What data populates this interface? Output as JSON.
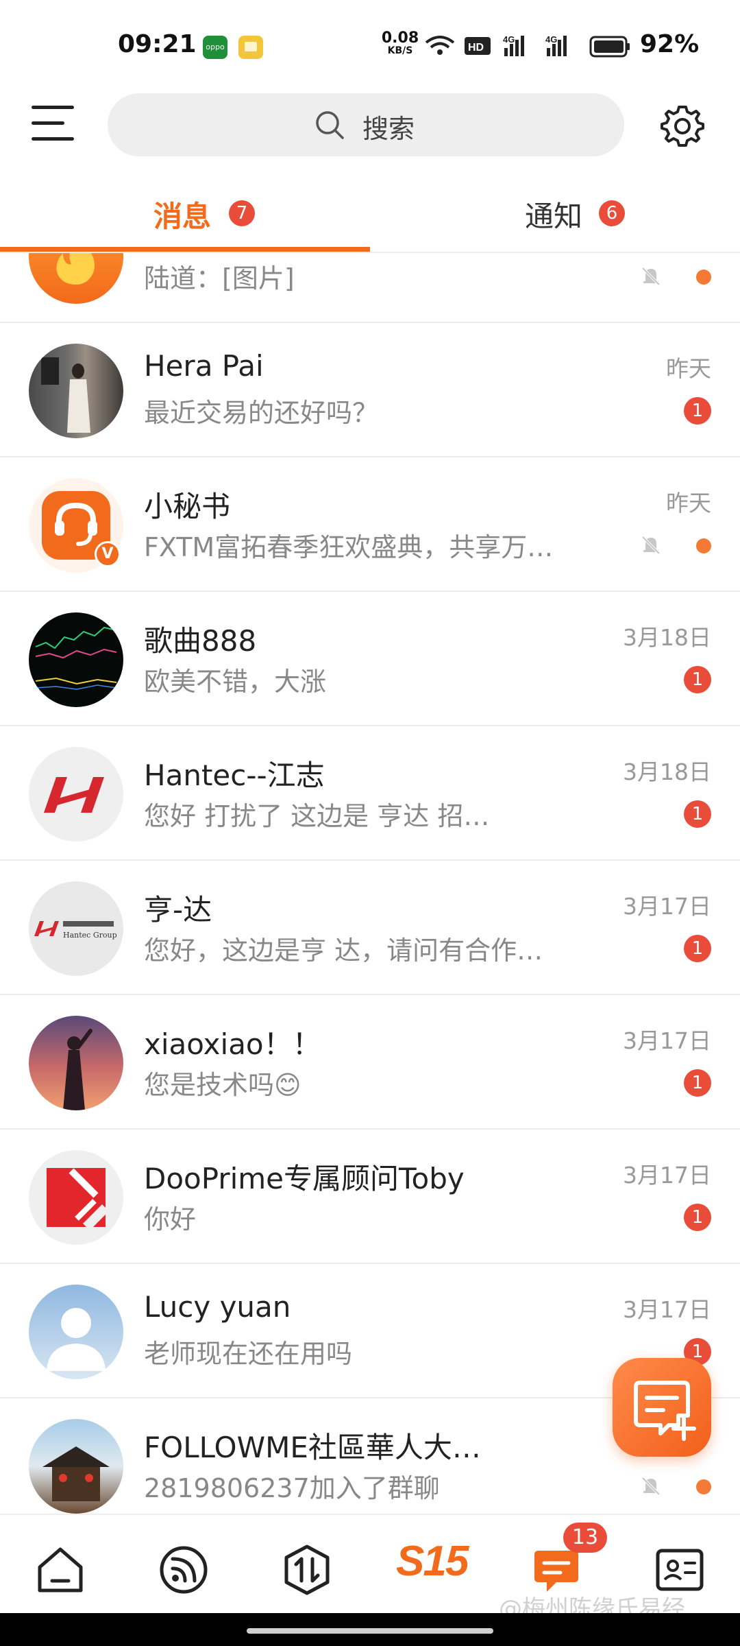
{
  "status_bar": {
    "time": "09:21",
    "net_speed_value": "0.08",
    "net_speed_unit": "KB/S",
    "battery_pct": "92%",
    "app_icon1_label": "oppo"
  },
  "header": {
    "search_placeholder": "搜索"
  },
  "tabs": [
    {
      "label": "消息",
      "badge": "7",
      "active": true
    },
    {
      "label": "通知",
      "badge": "6",
      "active": false
    }
  ],
  "conversations": [
    {
      "name": "",
      "preview": "陆道：[图片]",
      "time": "",
      "muted": true,
      "unread": ""
    },
    {
      "name": "Hera Pai",
      "preview": "最近交易的还好吗？",
      "time": "昨天",
      "muted": false,
      "unread": "1"
    },
    {
      "name": "小秘书",
      "preview": "FXTM富拓春季狂欢盛典，共享万…",
      "time": "昨天",
      "muted": true,
      "unread": ""
    },
    {
      "name": "歌曲888",
      "preview": "欧美不错，大涨",
      "time": "3月18日",
      "muted": false,
      "unread": "1"
    },
    {
      "name": "Hantec--江志",
      "preview": "您好  打扰了  这边是   亨达    招…",
      "time": "3月18日",
      "muted": false,
      "unread": "1"
    },
    {
      "name": "亨-达",
      "preview": "您好，这边是亨  达，请问有合作…",
      "time": "3月17日",
      "muted": false,
      "unread": "1"
    },
    {
      "name": "xiaoxiao！！",
      "preview": "您是技术吗😊",
      "time": "3月17日",
      "muted": false,
      "unread": "1"
    },
    {
      "name": "DooPrime专属顾问Toby",
      "preview": "你好",
      "time": "3月17日",
      "muted": false,
      "unread": "1"
    },
    {
      "name": "Lucy yuan",
      "preview": "老师现在还在用吗",
      "time": "3月17日",
      "muted": false,
      "unread": "1"
    },
    {
      "name": "FOLLOWME社區華人大…",
      "preview": "2819806237加入了群聊",
      "time": "",
      "muted": true,
      "unread": ""
    }
  ],
  "avatar_texts": {
    "hantec_logo_text": "Hantec Group"
  },
  "bottom_nav": {
    "s15_label": "S15",
    "messages_badge": "13"
  },
  "watermark": "@梅州陈缘氏易经",
  "colors": {
    "accent": "#f26a1b",
    "badge": "#e94d3a",
    "dot": "#f47a36"
  }
}
